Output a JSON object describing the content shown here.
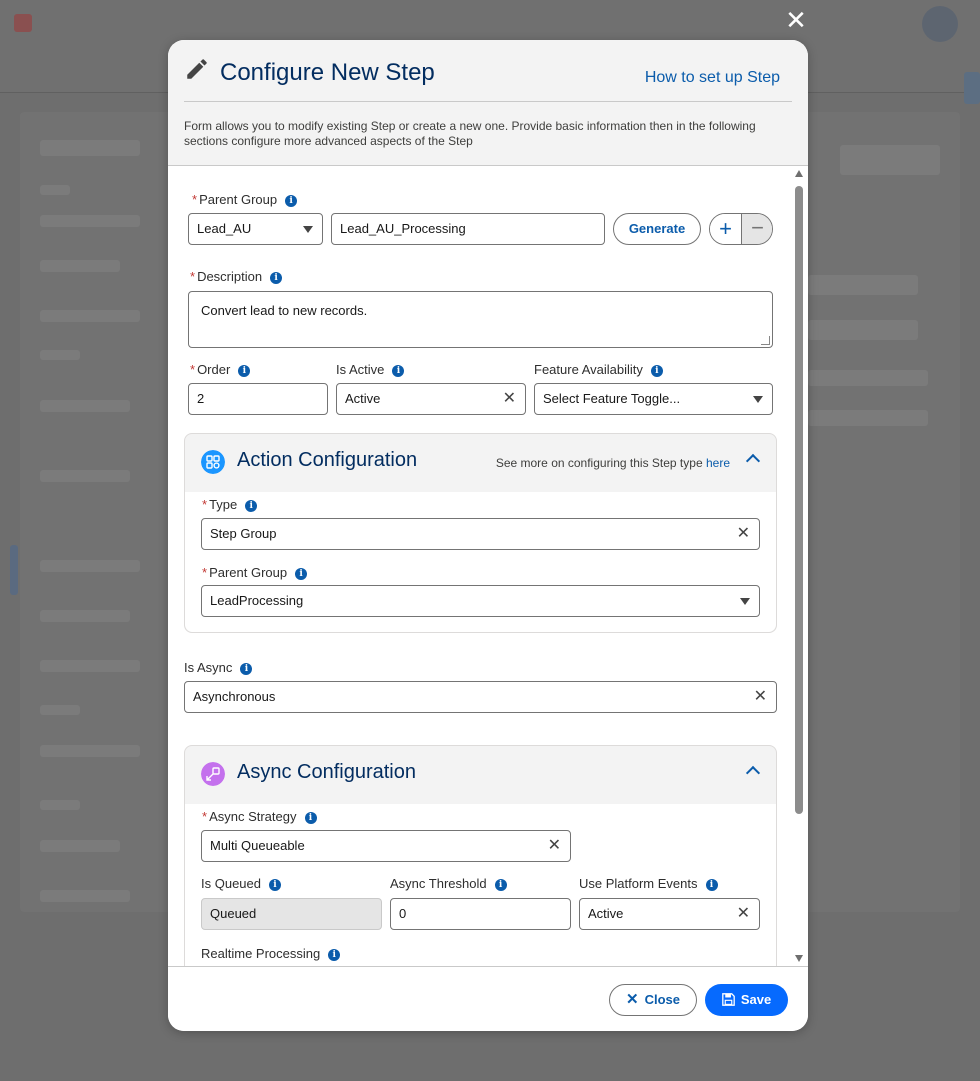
{
  "modal": {
    "title": "Configure New Step",
    "help_link": "How to set up Step",
    "description": "Form allows you to modify existing Step or create a new one. Provide basic information then in the following sections configure more advanced aspects of the Step"
  },
  "form": {
    "parent_group": {
      "label": "Parent Group",
      "selected": "Lead_AU",
      "name_value": "Lead_AU_Processing",
      "generate_label": "Generate",
      "plus": "+",
      "minus": "−"
    },
    "description": {
      "label": "Description",
      "value": "Convert lead to new records."
    },
    "order": {
      "label": "Order",
      "value": "2"
    },
    "is_active": {
      "label": "Is Active",
      "value": "Active"
    },
    "feature_availability": {
      "label": "Feature Availability",
      "placeholder": "Select Feature Toggle..."
    },
    "is_async": {
      "label": "Is Async",
      "value": "Asynchronous"
    }
  },
  "action_config": {
    "title": "Action Configuration",
    "see_more_text": "See more on configuring this Step type",
    "see_more_link": "here",
    "type": {
      "label": "Type",
      "value": "Step Group"
    },
    "parent_group": {
      "label": "Parent Group",
      "value": "LeadProcessing"
    }
  },
  "async_config": {
    "title": "Async Configuration",
    "strategy": {
      "label": "Async Strategy",
      "value": "Multi Queueable"
    },
    "is_queued": {
      "label": "Is Queued",
      "value": "Queued"
    },
    "threshold": {
      "label": "Async Threshold",
      "value": "0"
    },
    "platform_events": {
      "label": "Use Platform Events",
      "value": "Active"
    },
    "realtime": {
      "label": "Realtime Processing"
    }
  },
  "footer": {
    "close_label": "Close",
    "save_label": "Save"
  },
  "icons": {
    "info": "info-icon",
    "clear": "✕",
    "close": "✕"
  },
  "colors": {
    "brand": "#066afe",
    "title": "#032d60",
    "link": "#0b5cab",
    "required": "#c23934"
  }
}
